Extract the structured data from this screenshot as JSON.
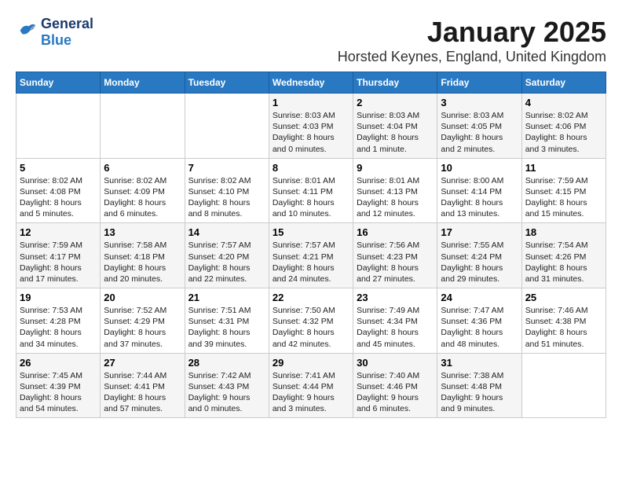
{
  "header": {
    "logo_general": "General",
    "logo_blue": "Blue",
    "title": "January 2025",
    "subtitle": "Horsted Keynes, England, United Kingdom"
  },
  "weekdays": [
    "Sunday",
    "Monday",
    "Tuesday",
    "Wednesday",
    "Thursday",
    "Friday",
    "Saturday"
  ],
  "weeks": [
    [
      {
        "day": "",
        "info": ""
      },
      {
        "day": "",
        "info": ""
      },
      {
        "day": "",
        "info": ""
      },
      {
        "day": "1",
        "info": "Sunrise: 8:03 AM\nSunset: 4:03 PM\nDaylight: 8 hours\nand 0 minutes."
      },
      {
        "day": "2",
        "info": "Sunrise: 8:03 AM\nSunset: 4:04 PM\nDaylight: 8 hours\nand 1 minute."
      },
      {
        "day": "3",
        "info": "Sunrise: 8:03 AM\nSunset: 4:05 PM\nDaylight: 8 hours\nand 2 minutes."
      },
      {
        "day": "4",
        "info": "Sunrise: 8:02 AM\nSunset: 4:06 PM\nDaylight: 8 hours\nand 3 minutes."
      }
    ],
    [
      {
        "day": "5",
        "info": "Sunrise: 8:02 AM\nSunset: 4:08 PM\nDaylight: 8 hours\nand 5 minutes."
      },
      {
        "day": "6",
        "info": "Sunrise: 8:02 AM\nSunset: 4:09 PM\nDaylight: 8 hours\nand 6 minutes."
      },
      {
        "day": "7",
        "info": "Sunrise: 8:02 AM\nSunset: 4:10 PM\nDaylight: 8 hours\nand 8 minutes."
      },
      {
        "day": "8",
        "info": "Sunrise: 8:01 AM\nSunset: 4:11 PM\nDaylight: 8 hours\nand 10 minutes."
      },
      {
        "day": "9",
        "info": "Sunrise: 8:01 AM\nSunset: 4:13 PM\nDaylight: 8 hours\nand 12 minutes."
      },
      {
        "day": "10",
        "info": "Sunrise: 8:00 AM\nSunset: 4:14 PM\nDaylight: 8 hours\nand 13 minutes."
      },
      {
        "day": "11",
        "info": "Sunrise: 7:59 AM\nSunset: 4:15 PM\nDaylight: 8 hours\nand 15 minutes."
      }
    ],
    [
      {
        "day": "12",
        "info": "Sunrise: 7:59 AM\nSunset: 4:17 PM\nDaylight: 8 hours\nand 17 minutes."
      },
      {
        "day": "13",
        "info": "Sunrise: 7:58 AM\nSunset: 4:18 PM\nDaylight: 8 hours\nand 20 minutes."
      },
      {
        "day": "14",
        "info": "Sunrise: 7:57 AM\nSunset: 4:20 PM\nDaylight: 8 hours\nand 22 minutes."
      },
      {
        "day": "15",
        "info": "Sunrise: 7:57 AM\nSunset: 4:21 PM\nDaylight: 8 hours\nand 24 minutes."
      },
      {
        "day": "16",
        "info": "Sunrise: 7:56 AM\nSunset: 4:23 PM\nDaylight: 8 hours\nand 27 minutes."
      },
      {
        "day": "17",
        "info": "Sunrise: 7:55 AM\nSunset: 4:24 PM\nDaylight: 8 hours\nand 29 minutes."
      },
      {
        "day": "18",
        "info": "Sunrise: 7:54 AM\nSunset: 4:26 PM\nDaylight: 8 hours\nand 31 minutes."
      }
    ],
    [
      {
        "day": "19",
        "info": "Sunrise: 7:53 AM\nSunset: 4:28 PM\nDaylight: 8 hours\nand 34 minutes."
      },
      {
        "day": "20",
        "info": "Sunrise: 7:52 AM\nSunset: 4:29 PM\nDaylight: 8 hours\nand 37 minutes."
      },
      {
        "day": "21",
        "info": "Sunrise: 7:51 AM\nSunset: 4:31 PM\nDaylight: 8 hours\nand 39 minutes."
      },
      {
        "day": "22",
        "info": "Sunrise: 7:50 AM\nSunset: 4:32 PM\nDaylight: 8 hours\nand 42 minutes."
      },
      {
        "day": "23",
        "info": "Sunrise: 7:49 AM\nSunset: 4:34 PM\nDaylight: 8 hours\nand 45 minutes."
      },
      {
        "day": "24",
        "info": "Sunrise: 7:47 AM\nSunset: 4:36 PM\nDaylight: 8 hours\nand 48 minutes."
      },
      {
        "day": "25",
        "info": "Sunrise: 7:46 AM\nSunset: 4:38 PM\nDaylight: 8 hours\nand 51 minutes."
      }
    ],
    [
      {
        "day": "26",
        "info": "Sunrise: 7:45 AM\nSunset: 4:39 PM\nDaylight: 8 hours\nand 54 minutes."
      },
      {
        "day": "27",
        "info": "Sunrise: 7:44 AM\nSunset: 4:41 PM\nDaylight: 8 hours\nand 57 minutes."
      },
      {
        "day": "28",
        "info": "Sunrise: 7:42 AM\nSunset: 4:43 PM\nDaylight: 9 hours\nand 0 minutes."
      },
      {
        "day": "29",
        "info": "Sunrise: 7:41 AM\nSunset: 4:44 PM\nDaylight: 9 hours\nand 3 minutes."
      },
      {
        "day": "30",
        "info": "Sunrise: 7:40 AM\nSunset: 4:46 PM\nDaylight: 9 hours\nand 6 minutes."
      },
      {
        "day": "31",
        "info": "Sunrise: 7:38 AM\nSunset: 4:48 PM\nDaylight: 9 hours\nand 9 minutes."
      },
      {
        "day": "",
        "info": ""
      }
    ]
  ]
}
